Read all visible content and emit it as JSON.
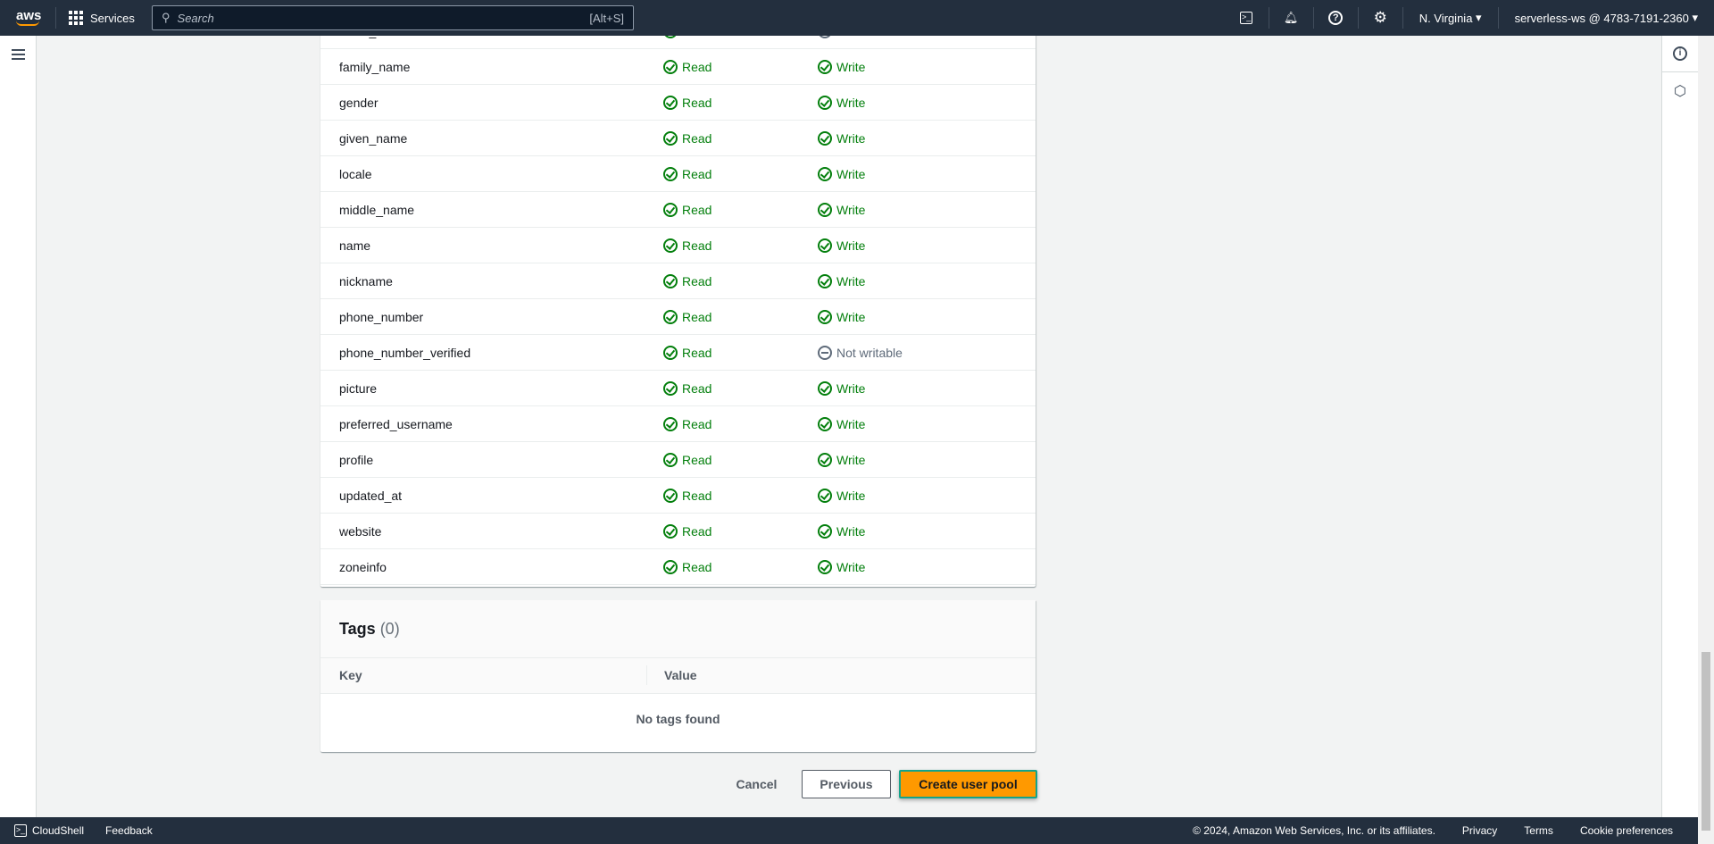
{
  "header": {
    "logo": "aws",
    "services": "Services",
    "search_placeholder": "Search",
    "search_shortcut": "[Alt+S]",
    "region": "N. Virginia",
    "account": "serverless-ws @ 4783-7191-2360",
    "icons": [
      "cloudshell-icon",
      "bell-icon",
      "help-icon",
      "gear-icon"
    ]
  },
  "attributes": [
    {
      "name": "email_verified",
      "read": "Read",
      "write": "Not writable",
      "writable": false
    },
    {
      "name": "family_name",
      "read": "Read",
      "write": "Write",
      "writable": true
    },
    {
      "name": "gender",
      "read": "Read",
      "write": "Write",
      "writable": true
    },
    {
      "name": "given_name",
      "read": "Read",
      "write": "Write",
      "writable": true
    },
    {
      "name": "locale",
      "read": "Read",
      "write": "Write",
      "writable": true
    },
    {
      "name": "middle_name",
      "read": "Read",
      "write": "Write",
      "writable": true
    },
    {
      "name": "name",
      "read": "Read",
      "write": "Write",
      "writable": true
    },
    {
      "name": "nickname",
      "read": "Read",
      "write": "Write",
      "writable": true
    },
    {
      "name": "phone_number",
      "read": "Read",
      "write": "Write",
      "writable": true
    },
    {
      "name": "phone_number_verified",
      "read": "Read",
      "write": "Not writable",
      "writable": false
    },
    {
      "name": "picture",
      "read": "Read",
      "write": "Write",
      "writable": true
    },
    {
      "name": "preferred_username",
      "read": "Read",
      "write": "Write",
      "writable": true
    },
    {
      "name": "profile",
      "read": "Read",
      "write": "Write",
      "writable": true
    },
    {
      "name": "updated_at",
      "read": "Read",
      "write": "Write",
      "writable": true
    },
    {
      "name": "website",
      "read": "Read",
      "write": "Write",
      "writable": true
    },
    {
      "name": "zoneinfo",
      "read": "Read",
      "write": "Write",
      "writable": true
    }
  ],
  "tags": {
    "title": "Tags",
    "count": "(0)",
    "col_key": "Key",
    "col_value": "Value",
    "empty": "No tags found"
  },
  "actions": {
    "cancel": "Cancel",
    "previous": "Previous",
    "create": "Create user pool"
  },
  "footer": {
    "cloudshell": "CloudShell",
    "feedback": "Feedback",
    "copyright": "© 2024, Amazon Web Services, Inc. or its affiliates.",
    "privacy": "Privacy",
    "terms": "Terms",
    "cookies": "Cookie preferences"
  },
  "colors": {
    "header": "#232f3e",
    "green": "#037f0c",
    "primary": "#ff9900",
    "highlight": "#14a38b"
  }
}
